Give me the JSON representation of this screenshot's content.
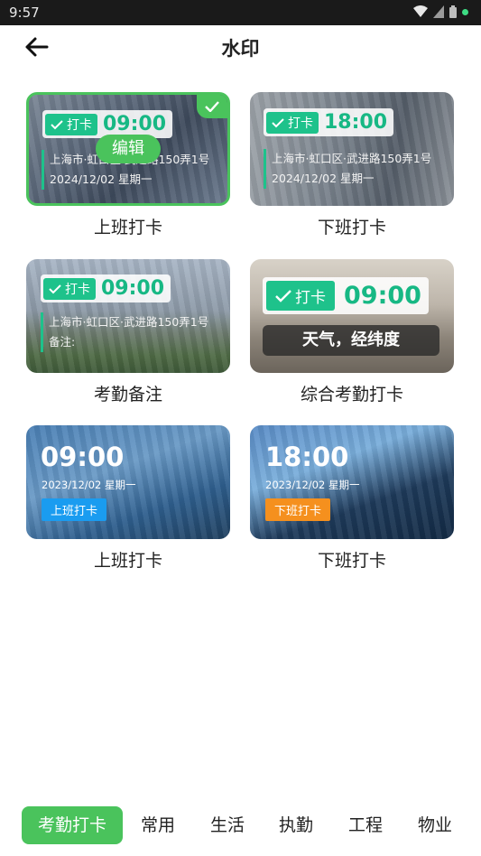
{
  "status_bar": {
    "time": "9:57"
  },
  "header": {
    "title": "水印"
  },
  "templates": [
    {
      "label": "上班打卡",
      "tag": "打卡",
      "time": "09:00",
      "address": "上海市·虹口区·武进路150弄1号",
      "date": "2024/12/02 星期一",
      "edit_label": "编辑"
    },
    {
      "label": "下班打卡",
      "tag": "打卡",
      "time": "18:00",
      "address": "上海市·虹口区·武进路150弄1号",
      "date": "2024/12/02 星期一"
    },
    {
      "label": "考勤备注",
      "tag": "打卡",
      "time": "09:00",
      "address": "上海市·虹口区·武进路150弄1号",
      "note": "备注:"
    },
    {
      "label": "综合考勤打卡",
      "tag": "打卡",
      "time": "09:00",
      "extra": "天气，经纬度"
    },
    {
      "label": "上班打卡",
      "time": "09:00",
      "date": "2023/12/02 星期一",
      "badge": "上班打卡",
      "badge_color": "#1a9cf0"
    },
    {
      "label": "下班打卡",
      "time": "18:00",
      "date": "2023/12/02 星期一",
      "badge": "下班打卡",
      "badge_color": "#f5901e"
    }
  ],
  "tabs": [
    "考勤打卡",
    "常用",
    "生活",
    "执勤",
    "工程",
    "物业"
  ],
  "colors": {
    "accent": "#4ac35c",
    "watermark_green": "#1ec28b"
  }
}
